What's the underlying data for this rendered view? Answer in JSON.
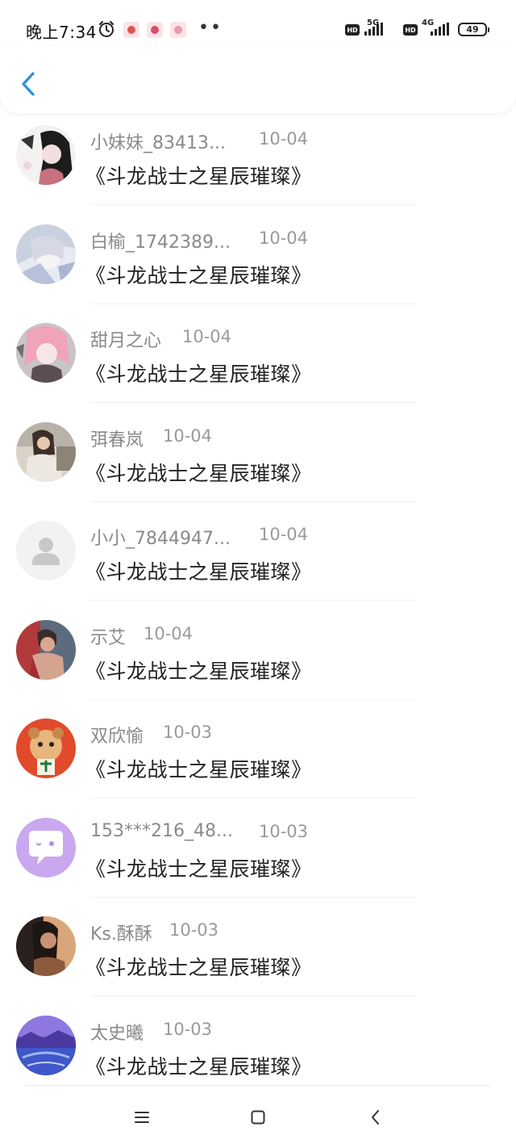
{
  "status_bar": {
    "time": "晚上7:34",
    "network1": "5G",
    "network2": "4G",
    "hd": "HD",
    "battery": "49"
  },
  "header": {
    "back_icon": "chevron-left-icon",
    "accent_color": "#2f8fe0"
  },
  "entries": [
    {
      "username": "小妹妹_83413...",
      "date": "10-04",
      "title": "《斗龙战士之星辰璀璨》"
    },
    {
      "username": "白榆_1742389...",
      "date": "10-04",
      "title": "《斗龙战士之星辰璀璨》"
    },
    {
      "username": "甜月之心",
      "date": "10-04",
      "title": "《斗龙战士之星辰璀璨》"
    },
    {
      "username": "弭春岚",
      "date": "10-04",
      "title": "《斗龙战士之星辰璀璨》"
    },
    {
      "username": "小小_7844947...",
      "date": "10-04",
      "title": "《斗龙战士之星辰璀璨》"
    },
    {
      "username": "示艾",
      "date": "10-04",
      "title": "《斗龙战士之星辰璀璨》"
    },
    {
      "username": "双欣愉",
      "date": "10-03",
      "title": "《斗龙战士之星辰璀璨》"
    },
    {
      "username": "153***216_48...",
      "date": "10-03",
      "title": "《斗龙战士之星辰璀璨》"
    },
    {
      "username": "Ks.酥酥",
      "date": "10-03",
      "title": "《斗龙战士之星辰璀璨》"
    },
    {
      "username": "太史曦",
      "date": "10-03",
      "title": "《斗龙战士之星辰璀璨》"
    }
  ],
  "nav": {
    "menu_icon": "menu-icon",
    "home_icon": "home-square-icon",
    "back_icon": "back-chevron-icon"
  }
}
